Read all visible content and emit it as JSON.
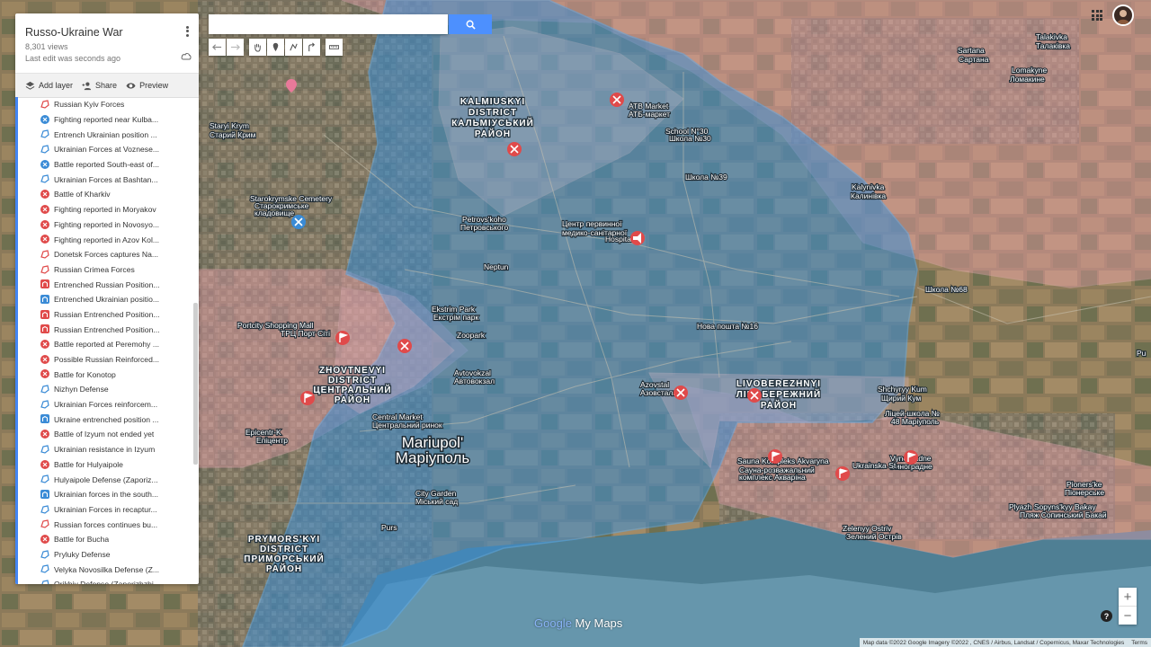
{
  "panel": {
    "title": "Russo-Ukraine War",
    "views": "8,301 views",
    "last_edit": "Last edit was seconds ago",
    "toolbar": {
      "add_layer": "Add layer",
      "share": "Share",
      "preview": "Preview"
    },
    "layers": [
      {
        "label": "Russian Kyiv Forces",
        "icon": "outline-red"
      },
      {
        "label": "Fighting reported near Kulba...",
        "icon": "blue"
      },
      {
        "label": "Entrench Ukrainian position ...",
        "icon": "outline-blue"
      },
      {
        "label": "Ukrainian Forces at Voznese...",
        "icon": "outline-blue"
      },
      {
        "label": "Battle reported South-east of...",
        "icon": "blue"
      },
      {
        "label": "Ukrainian Forces at Bashtan...",
        "icon": "outline-blue"
      },
      {
        "label": "Battle of Kharkiv",
        "icon": "red"
      },
      {
        "label": "Fighting reported in Moryakov",
        "icon": "red"
      },
      {
        "label": "Fighting reported in Novosyo...",
        "icon": "red"
      },
      {
        "label": "Fighting reported in Azov Kol...",
        "icon": "red"
      },
      {
        "label": "Donetsk Forces captures Na...",
        "icon": "outline-red"
      },
      {
        "label": "Russian Crimea Forces",
        "icon": "outline-red"
      },
      {
        "label": "Entrenched Russian Position...",
        "icon": "redrect"
      },
      {
        "label": "Entrenched Ukrainian positio...",
        "icon": "bluerect"
      },
      {
        "label": "Russian Entrenched Position...",
        "icon": "redrect"
      },
      {
        "label": "Russian Entrenched Position...",
        "icon": "redrect"
      },
      {
        "label": "Battle reported at Peremohy ...",
        "icon": "red"
      },
      {
        "label": "Possible Russian Reinforced...",
        "icon": "red"
      },
      {
        "label": "Battle for Konotop",
        "icon": "red"
      },
      {
        "label": "Nizhyn Defense",
        "icon": "outline-blue"
      },
      {
        "label": "Ukrainian Forces reinforcem...",
        "icon": "outline-blue"
      },
      {
        "label": "Ukraine entrenched position ...",
        "icon": "bluerect"
      },
      {
        "label": "Battle of Izyum not ended yet",
        "icon": "red"
      },
      {
        "label": "Ukrainian resistance in Izyum",
        "icon": "outline-blue"
      },
      {
        "label": "Battle for Hulyaipole",
        "icon": "red"
      },
      {
        "label": "Hulyaipole Defense (Zaporiz...",
        "icon": "outline-blue"
      },
      {
        "label": "Ukrainian forces in the south...",
        "icon": "bluerect"
      },
      {
        "label": "Ukrainian Forces in recaptur...",
        "icon": "outline-blue"
      },
      {
        "label": "Russian forces continues bu...",
        "icon": "outline-red"
      },
      {
        "label": "Battle for Bucha",
        "icon": "red"
      },
      {
        "label": "Pryluky Defense",
        "icon": "outline-blue"
      },
      {
        "label": "Velyka Novosilka Defense (Z...",
        "icon": "outline-blue"
      },
      {
        "label": "Orikhiv Defense (Zaporizhzhi...",
        "icon": "outline-blue"
      }
    ]
  },
  "search": {
    "placeholder": ""
  },
  "map_labels": {
    "kalmiuskyi": [
      "KALMIUSKYI",
      "DISTRICT",
      "КАЛЬМІУСЬКИЙ",
      "РАЙОН"
    ],
    "zhovtnevyi": [
      "ZHOVTNEVYI",
      "DISTRICT",
      "ЦЕНТРАЛЬНИЙ",
      "РАЙОН"
    ],
    "livoberezhnyi": [
      "LIVOBEREZHNYI",
      "ЛІВОБЕРЕЖНИЙ",
      "РАЙОН"
    ],
    "prymorskyi": [
      "PRYMORS'KYI",
      "DISTRICT",
      "ПРИМОРСЬКИЙ",
      "РАЙОН"
    ],
    "mariupol": [
      "Mariupol'",
      "Маріуполь"
    ],
    "places": [
      "Staryi Krym",
      "Старий Крим",
      "Starokrymske Cemetery",
      "Старокримське",
      "кладовище",
      "Petrovs'kohо",
      "Петровського",
      "Центр первинної",
      "медико-санітарної",
      "Hospital",
      "Neptun",
      "Ekstrim Park",
      "Екстрім парк",
      "Zoopark",
      "Avtovokzal",
      "Автовокзал",
      "Central Market",
      "Центральний ринок",
      "City Garden",
      "Міський сад",
      "Purs",
      "Pu",
      "Portcity Shopping Mall",
      "ТРЦ Порт Сіті",
      "Epicentr-K",
      "Епіцентр",
      "ATB Market",
      "АТБ-маркет",
      "School N°30",
      "Школа №30",
      "Школа №39",
      "Sartana",
      "Сартана",
      "Talakivka",
      "Талаківка",
      "Lomakyne",
      "Ломакине",
      "Kalynivka",
      "Калинівка",
      "Школа №68",
      "Нова пошта №16",
      "Azovstal",
      "Азовсталь",
      "Shchyryy Kum",
      "Щирий Кум",
      "Ліцей-школа №",
      "48 Маріуполь",
      "Vynohradne",
      "Виноградне",
      "Sauna Kompleks Akvaryna",
      "Сауна-розважальний",
      "комплекс Акваріна",
      "Pioners'ke",
      "Піонерське",
      "Plyazh Sopyns'kyy Bakay",
      "Пляж Сопинський Бакай",
      "Zelenyy Ostriv",
      "Зелений Острів",
      "Vynohradne",
      "Ukrainska St"
    ]
  },
  "logo": {
    "text1": "Google",
    "text2": "My Maps"
  },
  "attribution": {
    "text": "Map data ©2022 Google Imagery ©2022 , CNES / Airbus, Landsat / Copernicus, Maxar Technologies",
    "terms": "Terms"
  },
  "zoom": {
    "in": "+",
    "out": "−"
  },
  "help": "?",
  "colors": {
    "ukraine_area": "#3b8fd6",
    "russia_area": "#f5a3b3",
    "marker_red": "#e04a4a",
    "marker_blue": "#3a8bd6",
    "accent": "#4d90fe"
  }
}
